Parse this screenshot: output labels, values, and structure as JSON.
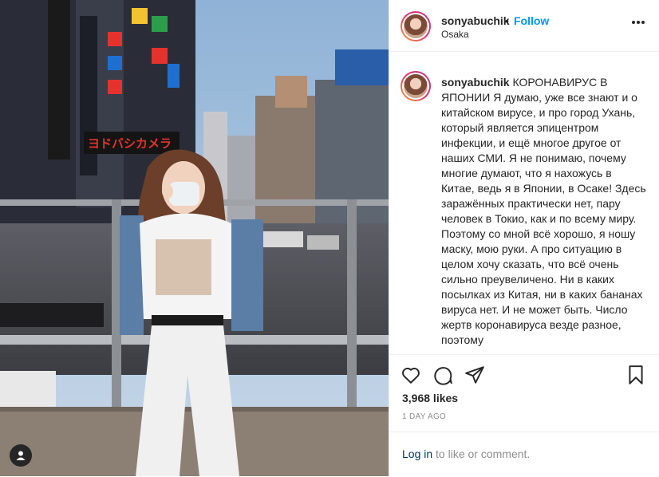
{
  "header": {
    "username": "sonyabuchik",
    "dot": "•",
    "follow_label": "Follow",
    "location": "Osaka"
  },
  "caption": {
    "username": "sonyabuchik",
    "text": "КОРОНАВИРУС В ЯПОНИИ Я думаю, уже все знают и о китайском вирусе, и про город Ухань, который является эпицентром инфекции, и ещё многое другое от наших СМИ. Я не понимаю, почему многие думают, что я нахожусь в Китае, ведь я в Японии, в Осаке! Здесь заражённых практически нет, пару человек в Токио, как и по всему миру. Поэтому со мной всё хорошо, я ношу маску, мою руки. А про ситуацию в целом хочу сказать, что всё очень сильно преувеличено. Ни в каких посылках из Китая, ни в каких бананах вируса нет. И не может быть. Число жертв коронавируса везде разное, поэтому"
  },
  "actions": {
    "like_icon": "heart-icon",
    "comment_icon": "speech-bubble-icon",
    "share_icon": "paper-plane-icon",
    "save_icon": "bookmark-icon"
  },
  "likes": "3,968 likes",
  "timestamp": "1 DAY AGO",
  "login": {
    "link_label": "Log in",
    "rest": " to like or comment."
  },
  "colors": {
    "accent": "#0095f6",
    "text": "#262626",
    "muted": "#8e8e8e",
    "link": "#00376b"
  }
}
